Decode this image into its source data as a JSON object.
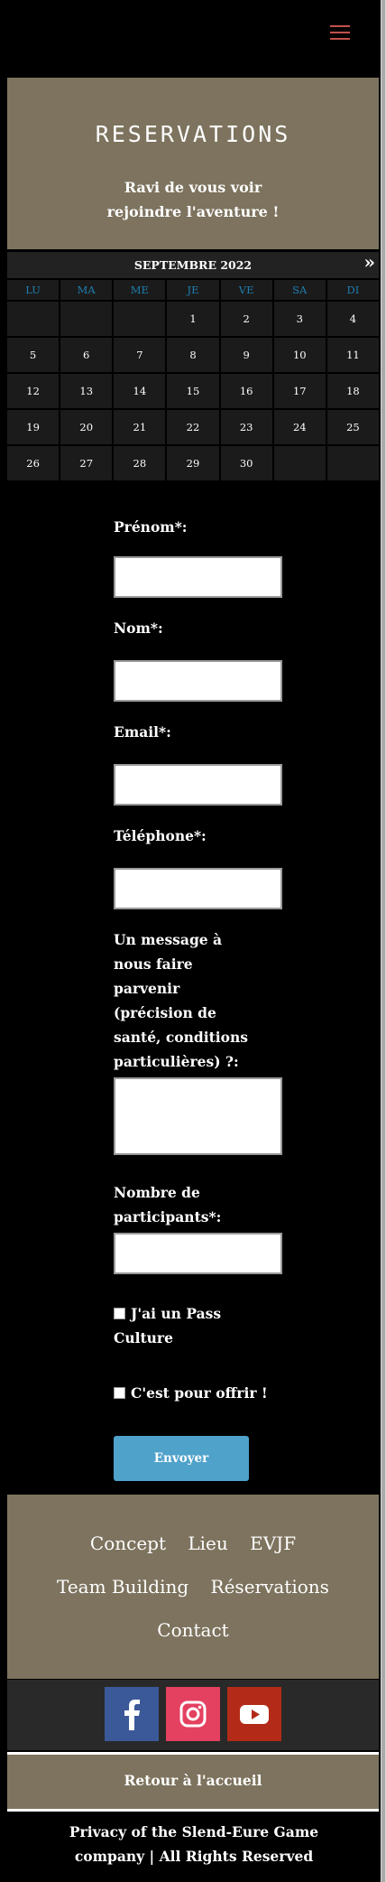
{
  "header": {
    "menu_icon": "hamburger-icon",
    "accent": "#c0504a"
  },
  "hero": {
    "title": "RESERVATIONS",
    "subtitle": "Ravi de vous voir rejoindre l'aventure !"
  },
  "calendar": {
    "month_label": "SEPTEMBRE 2022",
    "next_label": "»",
    "weekdays": [
      "LU",
      "MA",
      "ME",
      "JE",
      "VE",
      "SA",
      "DI"
    ],
    "days": [
      "",
      "",
      "",
      "1",
      "2",
      "3",
      "4",
      "5",
      "6",
      "7",
      "8",
      "9",
      "10",
      "11",
      "12",
      "13",
      "14",
      "15",
      "16",
      "17",
      "18",
      "19",
      "20",
      "21",
      "22",
      "23",
      "24",
      "25",
      "26",
      "27",
      "28",
      "29",
      "30",
      "",
      ""
    ],
    "weekday_color": "#1f7fb0"
  },
  "form": {
    "prenom_label": "Prénom*:",
    "nom_label": "Nom*:",
    "email_label": "Email*:",
    "telephone_label": "Téléphone*:",
    "message_label": "Un message à nous faire parvenir (précision de santé, conditions particulières) ?:",
    "participants_label": "Nombre de participants*:",
    "pass_culture_label": "J'ai un Pass Culture",
    "offrir_label": "C'est pour offrir !",
    "submit_label": "Envoyer",
    "submit_color": "#4fa2ca"
  },
  "footer": {
    "links": [
      "Concept",
      "Lieu",
      "EVJF",
      "Team Building",
      "Réservations",
      "Contact"
    ],
    "bg_color": "#7d735e"
  },
  "social": {
    "items": [
      {
        "icon": "facebook-icon",
        "color": "#3b5998"
      },
      {
        "icon": "instagram-icon",
        "color": "#e4405f"
      },
      {
        "icon": "youtube-icon",
        "color": "#b32b18"
      }
    ]
  },
  "retour": {
    "label": "Retour à l'accueil"
  },
  "privacy": {
    "text": "Privacy of the Slend-Eure Game company | All Rights Reserved"
  }
}
